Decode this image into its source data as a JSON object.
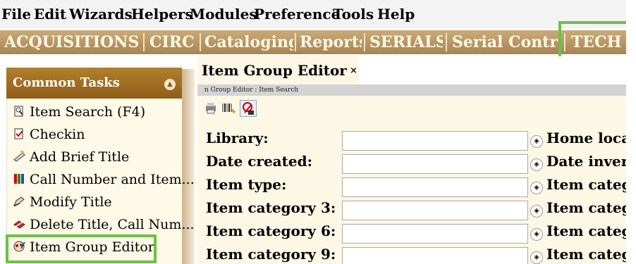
{
  "menu": [
    "File",
    "Edit",
    "Wizards",
    "Helpers",
    "Modules",
    "Preference",
    "Tools",
    "Help"
  ],
  "modules": [
    "ACQUISITIONS",
    "CIRC",
    "Cataloging",
    "Reports",
    "SERIALS",
    "Serial Control",
    "TECH"
  ],
  "common_tasks": {
    "title": "Common Tasks",
    "items": [
      {
        "label": "Item Search (F4)",
        "icon": "item-search-icon"
      },
      {
        "label": "Checkin",
        "icon": "checkin-icon"
      },
      {
        "label": "Add Brief Title",
        "icon": "add-title-icon"
      },
      {
        "label": "Call Number and Item...",
        "icon": "books-icon"
      },
      {
        "label": "Modify Title",
        "icon": "modify-title-icon"
      },
      {
        "label": "Delete Title, Call Num...",
        "icon": "delete-title-icon"
      },
      {
        "label": "Item Group Editor",
        "icon": "item-group-editor-icon"
      }
    ]
  },
  "editor": {
    "tab_title": "Item Group Editor",
    "close": "×",
    "breadcrumb": "n Group Editor : Item Search",
    "fields_left": [
      "Library:",
      "Date created:",
      "Item type:",
      "Item category 3:",
      "Item category 6:",
      "Item category 9:"
    ],
    "fields_right": [
      "Home loca",
      "Date inver",
      "Item categ",
      "Item categ",
      "Item categ",
      "Item categ"
    ]
  },
  "colors": {
    "highlight": "#6cc04a",
    "module_bar": "#a88450",
    "panel_header": "#8f5e18"
  }
}
